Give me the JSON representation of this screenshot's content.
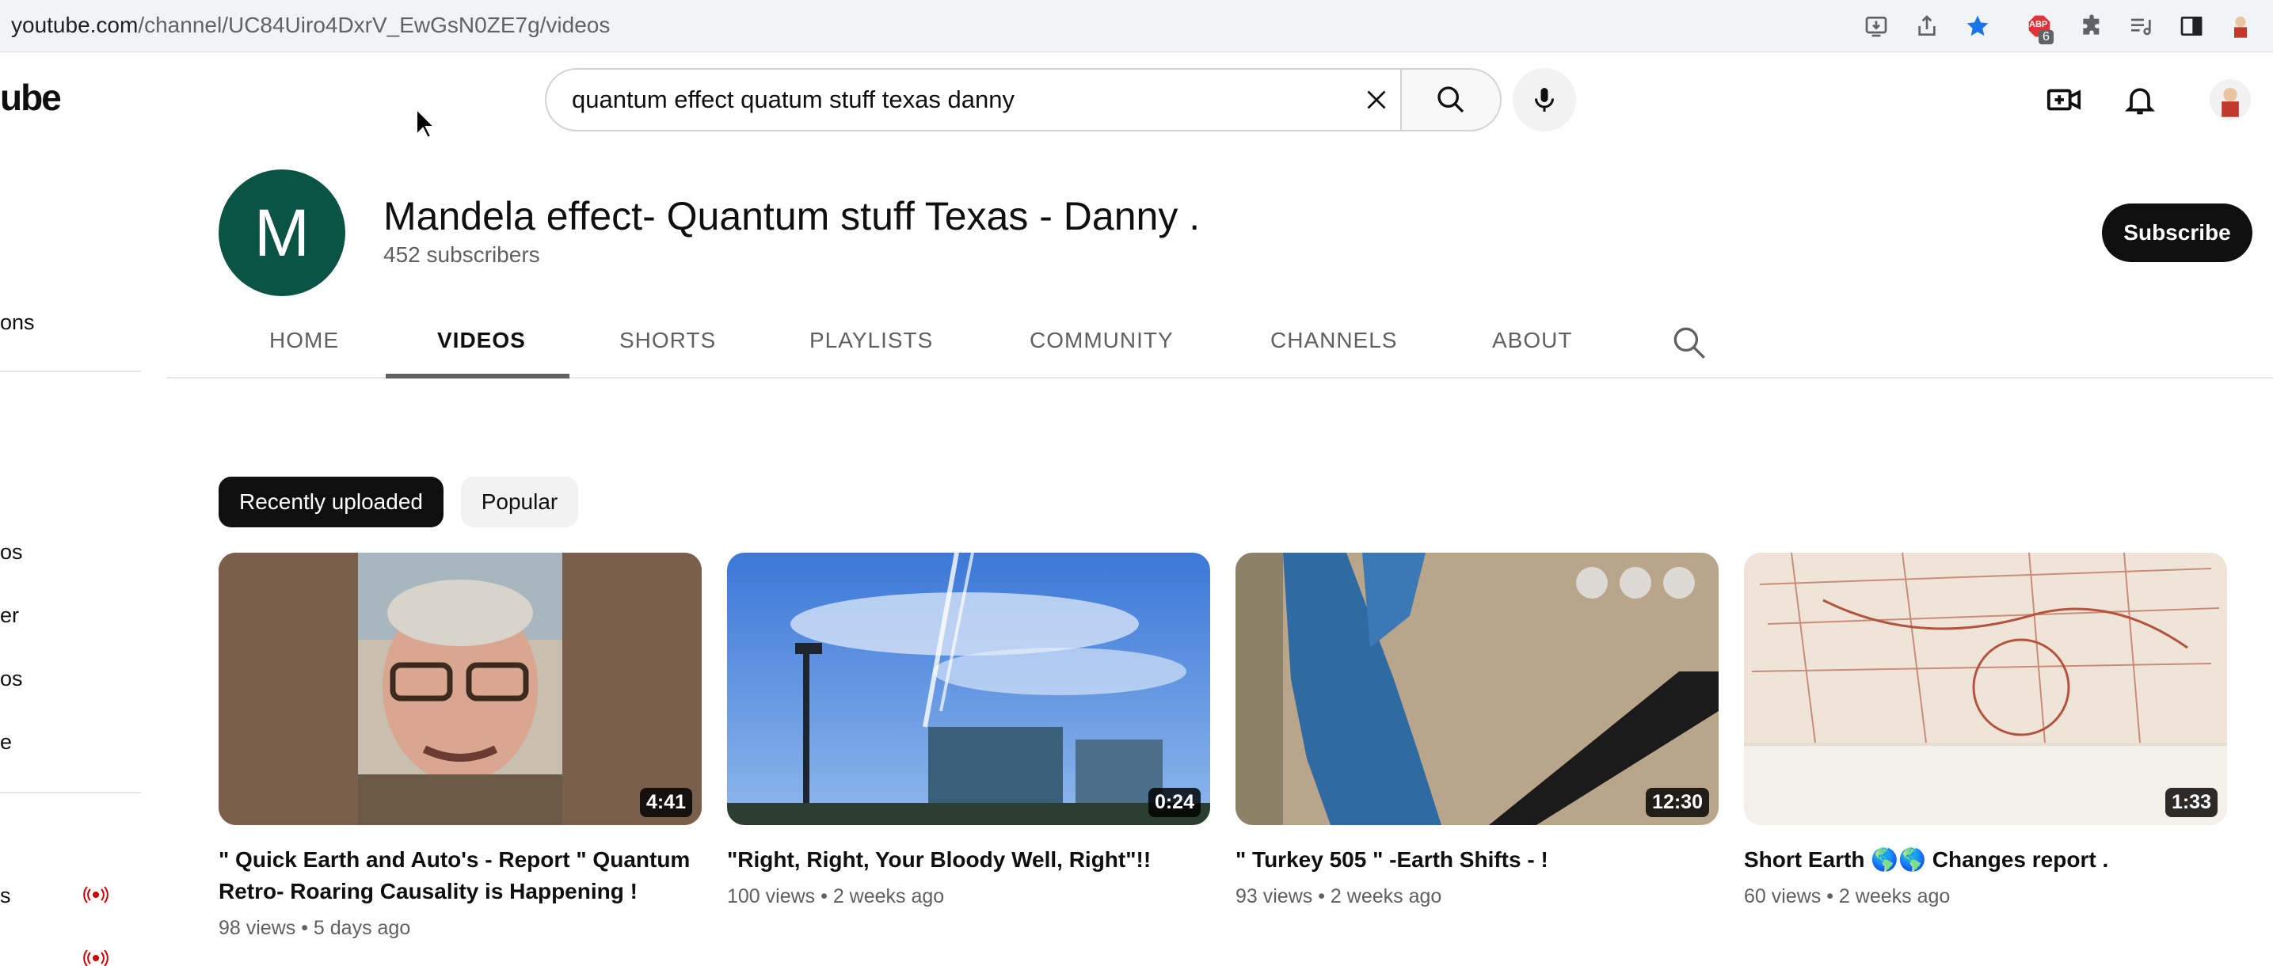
{
  "browser": {
    "url_domain": "youtube.com",
    "url_path": "/channel/UC84Uiro4DxrV_EwGsN0ZE7g/videos",
    "extension_badge": "6",
    "extension_label": "ABP",
    "icons": [
      "install-icon",
      "share-icon",
      "bookmark-star-icon",
      "adblock-icon",
      "extensions-puzzle-icon",
      "media-queue-icon",
      "side-panel-icon",
      "profile-icon"
    ]
  },
  "masthead": {
    "logo_fragment": "ube",
    "search_value": "quantum effect quatum stuff texas danny",
    "icons": [
      "clear-icon",
      "search-icon",
      "microphone-icon",
      "create-video-icon",
      "notifications-bell-icon",
      "account-avatar-icon"
    ]
  },
  "sidebar": {
    "fragments": [
      "ons",
      "os",
      "er",
      "os",
      "e",
      "s"
    ]
  },
  "channel": {
    "avatar_letter": "M",
    "title": "Mandela effect- Quantum stuff Texas - Danny .",
    "subscribers": "452 subscribers",
    "subscribe_label": "Subscribe"
  },
  "tabs": [
    {
      "label": "HOME",
      "active": false
    },
    {
      "label": "VIDEOS",
      "active": true
    },
    {
      "label": "SHORTS",
      "active": false
    },
    {
      "label": "PLAYLISTS",
      "active": false
    },
    {
      "label": "COMMUNITY",
      "active": false
    },
    {
      "label": "CHANNELS",
      "active": false
    },
    {
      "label": "ABOUT",
      "active": false
    }
  ],
  "chips": [
    {
      "label": "Recently uploaded",
      "active": true
    },
    {
      "label": "Popular",
      "active": false
    }
  ],
  "videos": [
    {
      "title": "\" Quick Earth and Auto's - Report \" Quantum Retro- Roaring Causality is Happening !",
      "duration": "4:41",
      "views": "98 views",
      "age": "5 days ago"
    },
    {
      "title": "\"Right, Right, Your Bloody Well, Right\"!!",
      "duration": "0:24",
      "views": "100 views",
      "age": "2 weeks ago"
    },
    {
      "title": "\" Turkey 505 \" -Earth Shifts - !",
      "duration": "12:30",
      "views": "93 views",
      "age": "2 weeks ago"
    },
    {
      "title": "Short Earth 🌎🌎 Changes report .",
      "duration": "1:33",
      "views": "60 views",
      "age": "2 weeks ago"
    }
  ],
  "colors": {
    "accent": "#0f0f0f",
    "avatar_bg": "#0b5345",
    "live_red": "#cc0000",
    "bookmark_blue": "#1a73e8"
  }
}
